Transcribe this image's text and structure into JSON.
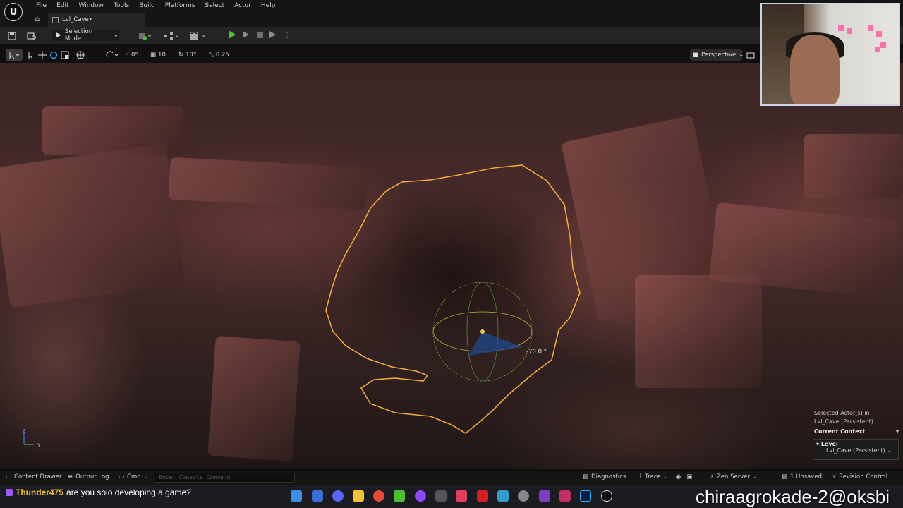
{
  "menu": [
    "File",
    "Edit",
    "Window",
    "Tools",
    "Build",
    "Platforms",
    "Select",
    "Actor",
    "Help"
  ],
  "tab": {
    "label": "Lvl_Cave•"
  },
  "toolbar": {
    "selection_mode": "Selection Mode"
  },
  "viewport_toolbar": {
    "rotation_angle": "0°",
    "grid_size": "10",
    "rotation_snap": "10°",
    "scale_snap": "0.25",
    "view_mode": "Perspective"
  },
  "viewport": {
    "angle_readout": "-70.0 °"
  },
  "selection": {
    "selected_line1": "Selected Actor(s) in",
    "selected_line2": "Lvl_Cave (Persistent)",
    "context_title": "Current Context",
    "level_label": "Level",
    "level_value": "Lvl_Cave (Persistent)"
  },
  "statusbar": {
    "content_drawer": "Content Drawer",
    "output_log": "Output Log",
    "cmd": "Cmd",
    "console_placeholder": "Enter Console Command",
    "diagnostics": "Diagnostics",
    "trace": "Trace",
    "zen_server": "Zen Server",
    "unsaved": "1 Unsaved",
    "revision_control": "Revision Control"
  },
  "chat": {
    "user": "Thunder475",
    "message": "are you solo developing a game?"
  },
  "overlay": {
    "text": "chiraagrokade-2@oksbi"
  },
  "colors": {
    "selection_outline": "#f2a83c",
    "play_green": "#4cbe34",
    "accent": "#f2c230"
  }
}
